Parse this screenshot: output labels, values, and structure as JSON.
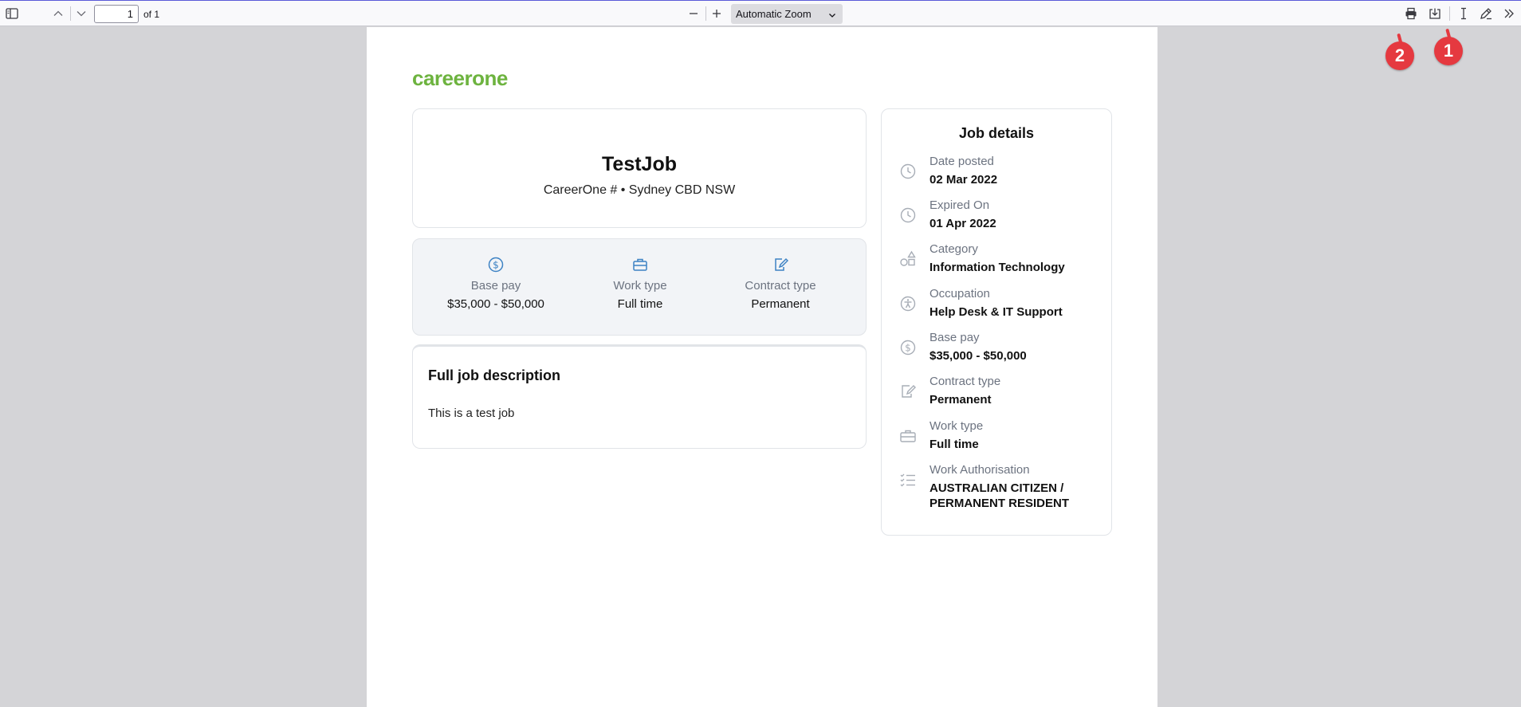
{
  "toolbar": {
    "page_number": "1",
    "page_of": "of 1",
    "zoom": "Automatic Zoom"
  },
  "badges": [
    "2",
    "1"
  ],
  "logo": "careerone",
  "job": {
    "title": "TestJob",
    "subtitle": "CareerOne # • Sydney CBD NSW"
  },
  "summary": [
    {
      "icon": "dollar-icon",
      "label": "Base pay",
      "value": "$35,000 - $50,000"
    },
    {
      "icon": "briefcase-icon",
      "label": "Work type",
      "value": "Full time"
    },
    {
      "icon": "contract-icon",
      "label": "Contract type",
      "value": "Permanent"
    }
  ],
  "description": {
    "heading": "Full job description",
    "text": "This is a test job"
  },
  "details": {
    "heading": "Job details",
    "items": [
      {
        "icon": "clock-icon",
        "label": "Date posted",
        "value": "02 Mar 2022"
      },
      {
        "icon": "clock-icon",
        "label": "Expired On",
        "value": "01 Apr 2022"
      },
      {
        "icon": "shapes-icon",
        "label": "Category",
        "value": "Information Technology"
      },
      {
        "icon": "accessibility-icon",
        "label": "Occupation",
        "value": "Help Desk & IT Support"
      },
      {
        "icon": "dollar-icon",
        "label": "Base pay",
        "value": "$35,000 - $50,000"
      },
      {
        "icon": "contract-icon",
        "label": "Contract type",
        "value": "Permanent"
      },
      {
        "icon": "briefcase-icon",
        "label": "Work type",
        "value": "Full time"
      },
      {
        "icon": "checklist-icon",
        "label": "Work Authorisation",
        "value": "AUSTRALIAN CITIZEN / PERMANENT RESIDENT"
      }
    ]
  }
}
